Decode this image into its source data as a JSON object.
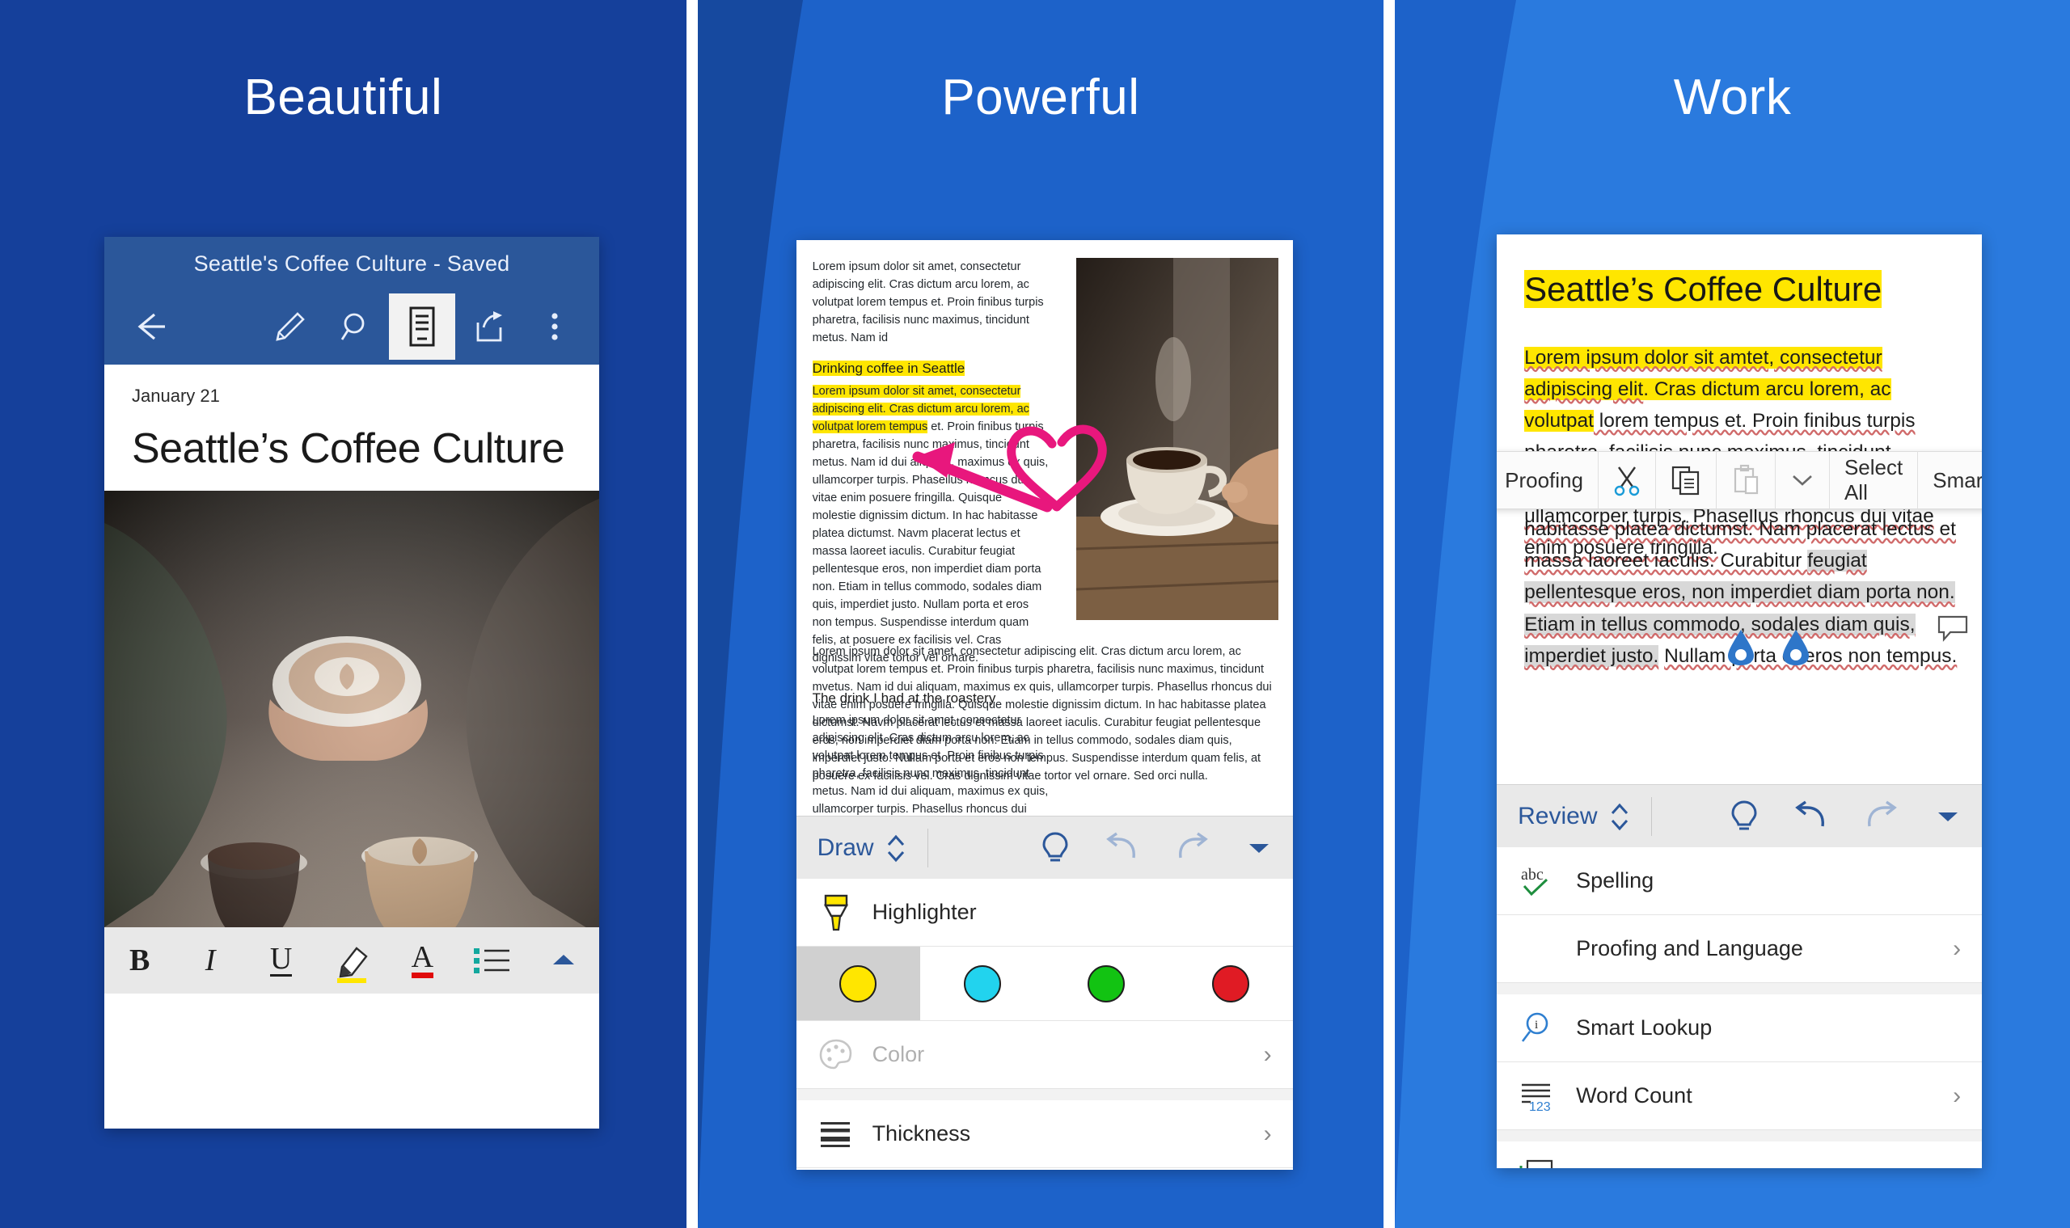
{
  "panels": [
    {
      "title": "Beautiful"
    },
    {
      "title": "Powerful"
    },
    {
      "title": "Work"
    }
  ],
  "colors": {
    "panel1_bg": "#15409b",
    "panel2_bg": "#1d62c9",
    "panel3_bg": "#2a7ade",
    "word_blue": "#2b579a",
    "highlight_yellow": "#ffe600",
    "ink_pink": "#e8177d",
    "swatch_yellow": "#ffe600",
    "swatch_cyan": "#22d3ee",
    "swatch_green": "#12c312",
    "swatch_red": "#e01b24"
  },
  "panel1": {
    "app_title": "Seattle's Coffee Culture - Saved",
    "back_icon": "back-arrow-icon",
    "toolbar_icons": [
      {
        "name": "pen-icon",
        "active": false
      },
      {
        "name": "search-icon",
        "active": false
      },
      {
        "name": "reading-view-icon",
        "active": true
      },
      {
        "name": "share-icon",
        "active": false
      },
      {
        "name": "more-options-icon",
        "active": false
      }
    ],
    "date": "January 21",
    "doc_title": "Seattle’s Coffee Culture",
    "format_bar": [
      {
        "label": "B",
        "name": "bold-button"
      },
      {
        "label": "I",
        "name": "italic-button"
      },
      {
        "label": "U",
        "name": "underline-button"
      },
      {
        "label": "",
        "name": "highlighter-button"
      },
      {
        "label": "A",
        "name": "font-color-button"
      },
      {
        "label": "",
        "name": "bullet-list-button"
      },
      {
        "label": "",
        "name": "collapse-toolbar-button"
      }
    ]
  },
  "panel2": {
    "doc": {
      "intro": "Lorem ipsum dolor sit amet, consectetur adipiscing elit. Cras dictum arcu lorem, ac volutpat lorem tempus et. Proin finibus turpis pharetra, facilisis nunc maximus, tincidunt metus. Nam id",
      "heading1": "Drinking coffee in Seattle",
      "para1_highlighted": "Lorem ipsum dolor sit amet, consectetur adipiscing elit. Cras dictum arcu lorem, ac volutpat lorem tempus",
      "para1_rest": " et. Proin finibus turpis pharetra, facilisis nunc maximus, tincidunt metus. Nam id dui aliquam, maximus ex quis, ullamcorper turpis. Phasellus rhoncus dui vitae enim posuere fringilla. Quisque molestie dignissim dictum. In hac habitasse platea dictumst. Navm placerat lectus et massa laoreet iaculis. Curabitur feugiat pellentesque eros, non imperdiet diam porta non. Etiam in tellus commodo, sodales diam quis, imperdiet justo. Nullam porta et eros non tempus. Suspendisse interdum quam felis, at posuere ex facilisis vel. Cras dignissim vitae tortor vel ornare.",
      "heading2": "The drink I had at the roastery",
      "para2": "Lorem ipsum dolor sit amet, consectetur adipiscing elit. Cras dictum arcu lorem, ac volutpat lorem tempus et. Proin finibus turpis pharetra, facilisis nunc maximus, tincidunt metus. Nam id dui aliquam, maximus ex quis, ullamcorper turpis. Phasellus rhoncus dui vitae enim posuere fringilla. Quisque molestie dignissim dictum. In hac",
      "para_full": "Lorem ipsum dolor sit amet, consectetur adipiscing elit. Cras dictum arcu lorem, ac volutpat lorem tempus et. Proin finibus turpis pharetra, facilisis nunc maximus, tincidunt mvetus. Nam id dui aliquam, maximus ex quis, ullamcorper turpis. Phasellus rhoncus dui vitae enim posuere fringilla. Quisque molestie dignissim dictum. In hac habitasse platea dictumst. Navm placerat lectus et massa laoreet iaculis. Curabitur feugiat pellentesque eros, non imperdiet diam porta non. Etiam in tellus commodo, sodales diam quis, imperdiet justo. Nullam porta et eros non tempus. Suspendisse interdum quam felis, at posuere ex facilisis vel. Cras dignissim vitae tortor vel ornare. Sed orci nulla.",
      "image_name": "coffee-cup-photo",
      "ink_annotation": "pink-heart-arrow-ink"
    },
    "ribbon": {
      "tab_label": "Draw",
      "tab_chevron_icon": "expand-collapse-icon",
      "tell_me_icon": "lightbulb-icon",
      "undo_icon": "undo-icon",
      "redo_icon": "redo-icon",
      "more_icon": "chevron-down-icon"
    },
    "menu": {
      "tool_label": "Highlighter",
      "tool_icon": "highlighter-icon",
      "swatches": [
        {
          "name": "swatch-yellow",
          "color": "#ffe600",
          "selected": true
        },
        {
          "name": "swatch-cyan",
          "color": "#22d3ee",
          "selected": false
        },
        {
          "name": "swatch-green",
          "color": "#12c312",
          "selected": false
        },
        {
          "name": "swatch-red",
          "color": "#e01b24",
          "selected": false
        }
      ],
      "color_label": "Color",
      "color_icon": "palette-icon",
      "thickness_label": "Thickness",
      "thickness_icon": "thickness-icon",
      "chevron": "›"
    }
  },
  "panel3": {
    "doc": {
      "title": "Seattle’s Coffee Culture",
      "para_a_hl1": "Lorem ipsum dolor sit amtet, consectetur adipiscing elit",
      "para_a_hl2": ". Cras dictum arcu lorem, ac volutpat",
      "para_a_rest": " lorem tempus et. Proin finibus turpis pharetra, facilisis nunc maximus, tincidunt mvetus. Nam id dui aliquam, maximus ex quis, ullamcorper turpis. Phasellus rhoncus dui vitae enim posuere fringilla.",
      "para_b_top": "habitasse platea dictumst. Nam placerat lectus et",
      "para_b_1": "massa laoreet iaculis. Curabitur ",
      "para_b_sel": "feugiat",
      "para_b_2": " pellentesque eros, non imperdiet diam porta non. Etiam in tellus commodo, sodales diam quis, imperdiet justo.",
      "para_b_3": "Nullam porta et eros non tempus.",
      "comment_icon": "comment-bubble-icon",
      "handle_icon": "selection-handle-icon"
    },
    "context_menu": {
      "items": [
        {
          "label": "Proofing",
          "name": "ctx-proofing",
          "icon": ""
        },
        {
          "label": "",
          "name": "ctx-cut",
          "icon": "scissors-icon"
        },
        {
          "label": "",
          "name": "ctx-copy",
          "icon": "copy-icon"
        },
        {
          "label": "",
          "name": "ctx-paste",
          "icon": "paste-icon"
        },
        {
          "label": "",
          "name": "ctx-more",
          "icon": "chevron-down-icon"
        },
        {
          "label": "Select All",
          "name": "ctx-select-all",
          "icon": ""
        },
        {
          "label": "Smart",
          "name": "ctx-smart-lookup",
          "icon": ""
        }
      ]
    },
    "ribbon": {
      "tab_label": "Review",
      "tab_chevron_icon": "expand-collapse-icon",
      "tell_me_icon": "lightbulb-icon",
      "undo_icon": "undo-icon",
      "redo_icon": "redo-icon",
      "more_icon": "chevron-down-icon"
    },
    "menu": {
      "items": [
        {
          "label": "Spelling",
          "icon": "spelling-abc-check-icon",
          "chevron": "",
          "name": "menu-item-spelling"
        },
        {
          "label": "Proofing and Language",
          "icon": "",
          "chevron": "›",
          "name": "menu-item-proofing-language"
        },
        {
          "label": "Smart Lookup",
          "icon": "smart-lookup-icon",
          "chevron": "",
          "name": "menu-item-smart-lookup"
        },
        {
          "label": "Word Count",
          "icon": "word-count-icon",
          "chevron": "›",
          "name": "menu-item-word-count"
        }
      ]
    }
  }
}
